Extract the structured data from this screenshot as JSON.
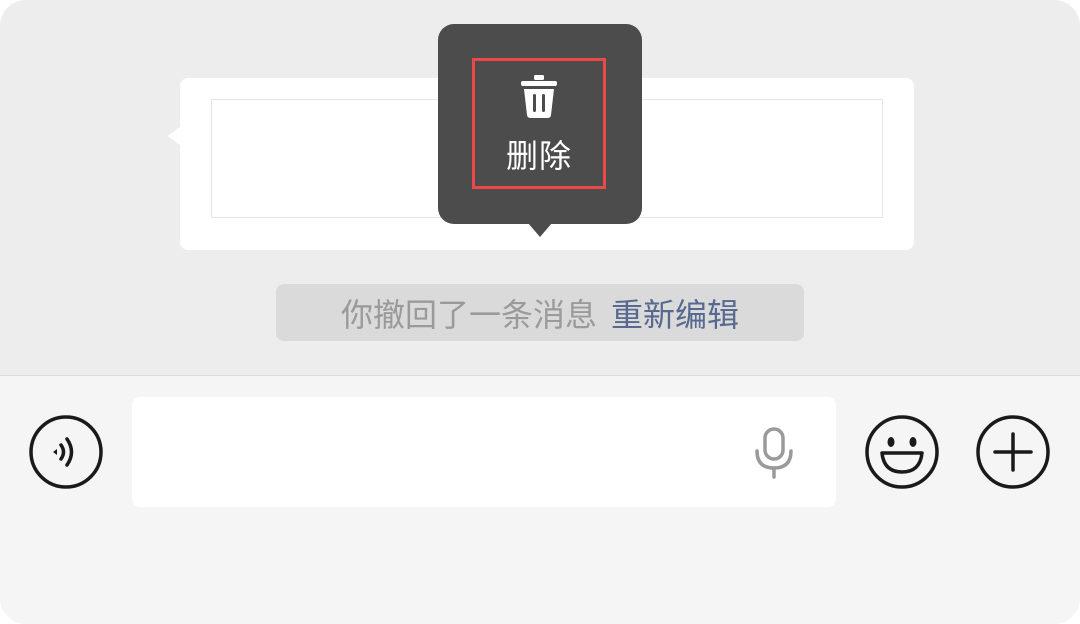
{
  "context_menu": {
    "delete_label": "删除",
    "delete_icon": "trash-icon"
  },
  "recall_notice": {
    "text": "你撤回了一条消息",
    "reedit_link": "重新编辑"
  },
  "input_bar": {
    "voice_icon": "voice-mode-icon",
    "message_value": "",
    "mic_icon": "microphone-icon",
    "emoji_icon": "emoji-icon",
    "plus_icon": "plus-icon"
  },
  "colors": {
    "chat_bg": "#ededed",
    "menu_bg": "#4c4c4c",
    "highlight_border": "#ec4848",
    "link": "#57698f"
  }
}
